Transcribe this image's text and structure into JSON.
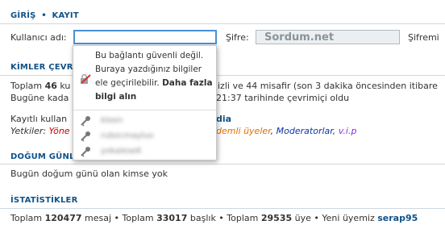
{
  "header": {
    "login": "GİRİŞ",
    "dot": "•",
    "register": "KAYIT"
  },
  "login_form": {
    "username_label": "Kullanıcı adı:",
    "username_value": "",
    "password_label": "Şifre:",
    "password_value": "Sordum.net",
    "remember_label": "Şifremi"
  },
  "autofill_popup": {
    "warning_1": "Bu bağlantı güvenli değil.",
    "warning_2": "Buraya yazdığınız bilgiler",
    "warning_3": "ele geçirilebilir.",
    "warning_link_1": "Daha fazla",
    "warning_link_2": "bilgi alın",
    "suggestions": [
      "kleen",
      "rubocmayluo",
      "yokaleseK"
    ]
  },
  "online": {
    "title": "KİMLER ÇEVRİ",
    "line1_a": "Toplam",
    "line1_count": "46",
    "line1_b": "ku",
    "line1_c": "izli ve",
    "line1_guests": "44",
    "line1_d": "misafir (son",
    "line1_minutes": "3",
    "line1_e": "dakika öncesinden itibare",
    "line2_a": "Bugüne kada",
    "line2_b": "21:37 tarihinde çevrimiçi oldu",
    "line3_a": "Kayıtlı kullan",
    "line3_b": "dia",
    "groups_label": "Yetkiler:",
    "group_1": "Yöne",
    "group_2": "demli üyeler",
    "group_3": "Moderatorlar",
    "group_4": "v.i.p",
    "comma": ","
  },
  "birthdays": {
    "title": "DOĞUM GÜNLERİ",
    "text": "Bugün doğum günü olan kimse yok"
  },
  "stats": {
    "title": "İSTATİSTİKLER",
    "toplam1": "Toplam",
    "messages": "120477",
    "mesaj": "mesaj •",
    "toplam2": "Toplam",
    "topics": "33017",
    "baslik": "başlık •",
    "toplam3": "Toplam",
    "members": "29535",
    "uye": "üye •",
    "new_member_label": "Yeni üyemiz",
    "new_member": "serap95"
  },
  "colors": {
    "heading": "#105289",
    "admin_group": "#cc0000",
    "senior_group": "#e07000",
    "moderator_group": "#0b35a8",
    "vip_group": "#8a2be2"
  },
  "icons": {
    "lock": "insecure-lock-icon",
    "key": "key-icon"
  }
}
